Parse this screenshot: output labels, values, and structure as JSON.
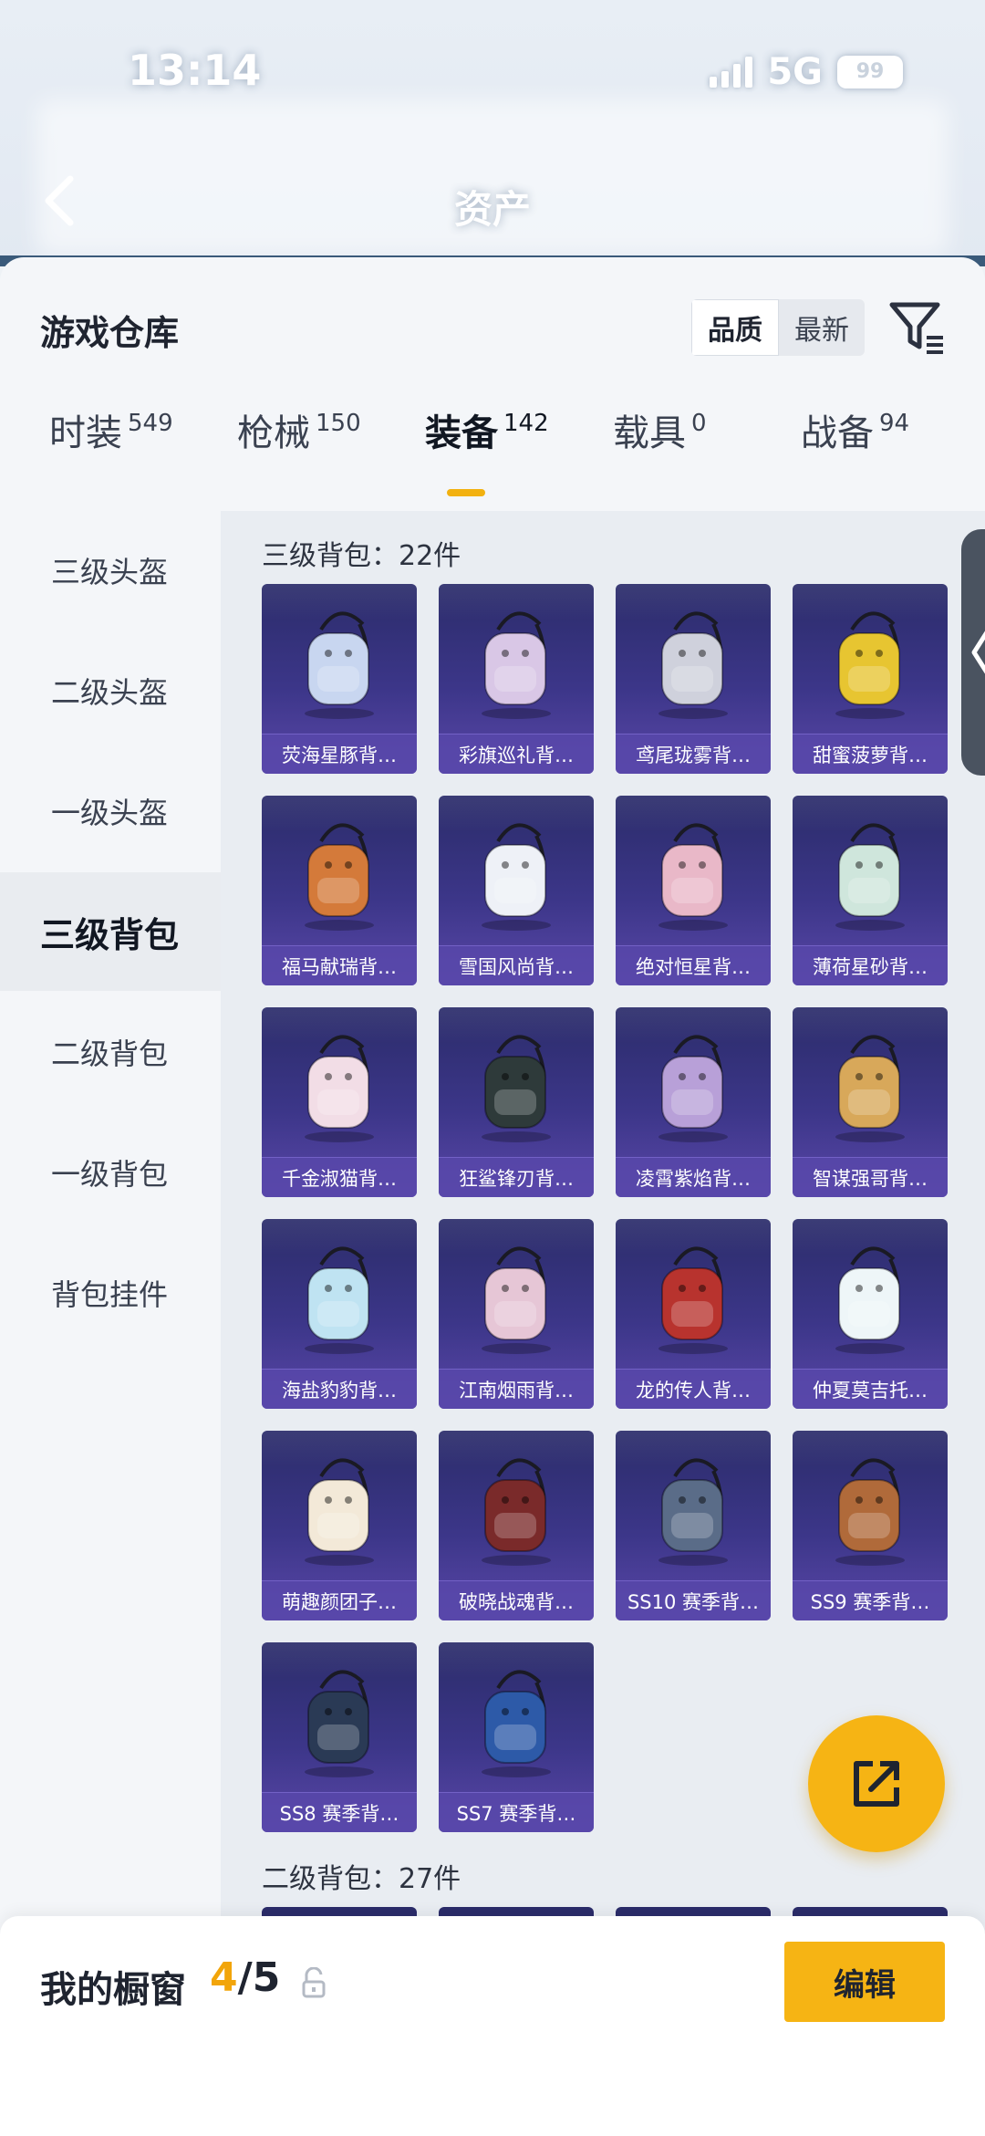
{
  "status_bar": {
    "time": "13:14",
    "network": "5G",
    "battery": "99"
  },
  "header": {
    "title": "资产"
  },
  "panel": {
    "title": "游戏仓库",
    "sort_options": [
      "品质",
      "最新"
    ],
    "active_sort": "品质"
  },
  "tabs": [
    {
      "label": "时装",
      "count": "549"
    },
    {
      "label": "枪械",
      "count": "150"
    },
    {
      "label": "装备",
      "count": "142"
    },
    {
      "label": "载具",
      "count": "0"
    },
    {
      "label": "战备",
      "count": "94"
    }
  ],
  "active_tab": "装备",
  "sidebar": {
    "items": [
      "三级头盔",
      "二级头盔",
      "一级头盔",
      "三级背包",
      "二级背包",
      "一级背包",
      "背包挂件"
    ],
    "active": "三级背包"
  },
  "sections": [
    {
      "header": "三级背包：22件"
    },
    {
      "header": "二级背包：27件"
    }
  ],
  "items": [
    {
      "name": "荧海星豚背…",
      "icon": "dolphin-backpack-icon",
      "color": "#c8d6f0"
    },
    {
      "name": "彩旗巡礼背…",
      "icon": "festival-backpack-icon",
      "color": "#d9c7e6"
    },
    {
      "name": "鸢尾珑雾背…",
      "icon": "iris-backpack-icon",
      "color": "#cfd1dc"
    },
    {
      "name": "甜蜜菠萝背…",
      "icon": "pineapple-backpack-icon",
      "color": "#e7c531"
    },
    {
      "name": "福马献瑞背…",
      "icon": "horse-backpack-icon",
      "color": "#d47a3a"
    },
    {
      "name": "雪国风尚背…",
      "icon": "penguin-backpack-icon",
      "color": "#eef1f7"
    },
    {
      "name": "绝对恒星背…",
      "icon": "popcorn-backpack-icon",
      "color": "#e9b8c8"
    },
    {
      "name": "薄荷星砂背…",
      "icon": "mint-backpack-icon",
      "color": "#cfe6dc"
    },
    {
      "name": "千金淑猫背…",
      "icon": "cat-backpack-icon",
      "color": "#f2dde6"
    },
    {
      "name": "狂鲨锋刃背…",
      "icon": "shark-backpack-icon",
      "color": "#2e3a3a"
    },
    {
      "name": "凌霄紫焰背…",
      "icon": "flame-backpack-icon",
      "color": "#b8a0d8"
    },
    {
      "name": "智谋强哥背…",
      "icon": "hamster-backpack-icon",
      "color": "#d8a85a"
    },
    {
      "name": "海盐豹豹背…",
      "icon": "seal-backpack-icon",
      "color": "#bfe3f2"
    },
    {
      "name": "江南烟雨背…",
      "icon": "bouquet-backpack-icon",
      "color": "#e6c6d6"
    },
    {
      "name": "龙的传人背…",
      "icon": "dragon-backpack-icon",
      "color": "#b8332e"
    },
    {
      "name": "仲夏莫吉托…",
      "icon": "mojito-backpack-icon",
      "color": "#eef6f8"
    },
    {
      "name": "萌趣颜团子…",
      "icon": "dumpling-backpack-icon",
      "color": "#f3e9d8"
    },
    {
      "name": "破晓战魂背…",
      "icon": "warrior-backpack-icon",
      "color": "#7a2a2a"
    },
    {
      "name": "SS10 赛季背…",
      "icon": "season-backpack-icon",
      "color": "#5a6c88"
    },
    {
      "name": "SS9 赛季背…",
      "icon": "season-backpack-icon",
      "color": "#b06a3a"
    },
    {
      "name": "SS8 赛季背…",
      "icon": "season-backpack-icon",
      "color": "#2a3a55"
    },
    {
      "name": "SS7 赛季背…",
      "icon": "season-backpack-icon",
      "color": "#2d5aa8"
    }
  ],
  "bottom_bar": {
    "title": "我的橱窗",
    "current": "4",
    "separator": "/",
    "max": "5",
    "edit_label": "编辑"
  },
  "colors": {
    "accent": "#f6b414",
    "card_bg": "#3c3689",
    "name_bar": "#5848aa"
  }
}
